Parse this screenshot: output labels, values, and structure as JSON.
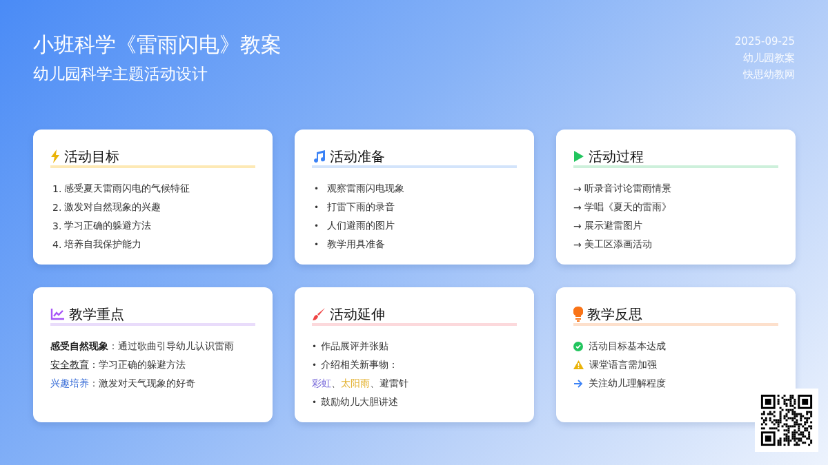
{
  "header": {
    "title": "小班科学《雷雨闪电》教案",
    "subtitle": "幼儿园科学主题活动设计",
    "meta": [
      "2025-09-25",
      "幼儿园教案",
      "快思幼教网"
    ]
  },
  "cards": [
    {
      "kind": "goals",
      "title": "活动目标",
      "color": "#fde9b5",
      "items": [
        {
          "mark": "1.",
          "text": "感受夏天雷雨闪电的气候特征"
        },
        {
          "mark": "2.",
          "text": "激发对自然现象的兴趣"
        },
        {
          "mark": "3.",
          "text": "学习正确的躲避方法"
        },
        {
          "mark": "4.",
          "text": "培养自我保护能力"
        }
      ]
    },
    {
      "kind": "prep",
      "title": "活动准备",
      "color": "#d3e4fb",
      "items": [
        {
          "mark": "•",
          "text": "观察雷雨闪电现象"
        },
        {
          "mark": "•",
          "text": "打雷下雨的录音"
        },
        {
          "mark": "•",
          "text": "人们避雨的图片"
        },
        {
          "mark": "•",
          "text": "教学用具准备"
        }
      ]
    },
    {
      "kind": "process",
      "title": "活动过程",
      "color": "#cdf0db",
      "items": [
        {
          "mark": "→",
          "text": "听录音讨论雷雨情景"
        },
        {
          "mark": "→",
          "text": "学唱《夏天的雷雨》"
        },
        {
          "mark": "→",
          "text": "展示避雷图片"
        },
        {
          "mark": "→",
          "text": "美工区添画活动"
        }
      ]
    },
    {
      "kind": "keypoints",
      "title": "教学重点",
      "color": "#e9dcfb",
      "items": [
        {
          "kind": "bold",
          "term": "感受自然现象",
          "text": "：通过歌曲引导幼儿认识雷雨"
        },
        {
          "kind": "underline",
          "term": "安全教育",
          "text": "：学习正确的躲避方法"
        },
        {
          "kind": "link",
          "term": "兴趣培养",
          "text": "：激发对天气现象的好奇"
        }
      ]
    },
    {
      "kind": "extension",
      "title": "活动延伸",
      "color": "#fcd9dc",
      "items": [
        {
          "kind": "bullet",
          "mark": "•",
          "text": "作品展评并张贴"
        },
        {
          "kind": "bullet",
          "mark": "•",
          "text": "介绍相关新事物："
        },
        {
          "kind": "segments",
          "segments": [
            {
              "text": "彩虹",
              "color": "#6b5bd6"
            },
            {
              "text": "、"
            },
            {
              "text": "太阳雨",
              "color": "#e3b02c"
            },
            {
              "text": "、避雷针"
            }
          ]
        },
        {
          "kind": "bullet",
          "mark": "•",
          "text": "鼓励幼儿大胆讲述"
        }
      ]
    },
    {
      "kind": "reflection",
      "title": "教学反思",
      "color": "#fde0cc",
      "items": [
        {
          "kind": "done",
          "text": "活动目标基本达成"
        },
        {
          "kind": "warning",
          "text": "课堂语言需加强"
        },
        {
          "kind": "next",
          "text": "关注幼儿理解程度"
        }
      ]
    }
  ]
}
